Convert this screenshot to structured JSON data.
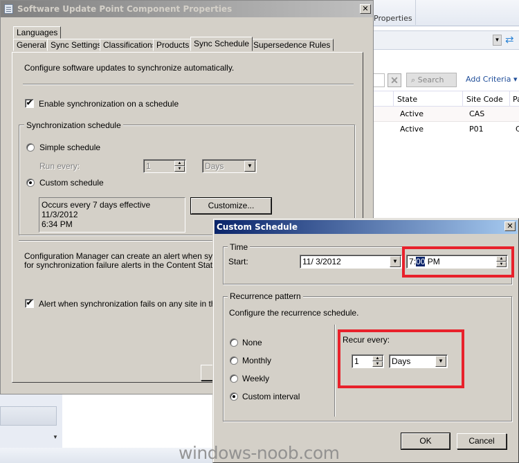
{
  "background_console": {
    "ribbon_tab": "Properties",
    "search_button": "Search",
    "add_criteria": "Add Criteria ▾",
    "columns": [
      "State",
      "Site Code",
      "Pa"
    ],
    "rows": [
      {
        "state": "Active",
        "site_code": "CAS",
        "extra": ""
      },
      {
        "state": "Active",
        "site_code": "P01",
        "extra": "C"
      }
    ]
  },
  "main_dialog": {
    "title": "Software Update Point Component Properties",
    "close_glyph": "✕",
    "tabs_row1": [
      "Languages"
    ],
    "tabs_row2": [
      "General",
      "Sync Settings",
      "Classifications",
      "Products",
      "Sync Schedule",
      "Supersedence Rules"
    ],
    "active_tab": "Sync Schedule",
    "intro": "Configure software updates to synchronize automatically.",
    "enable_sync_label": "Enable synchronization on a schedule",
    "enable_sync_checked": true,
    "schedule_group_label": "Synchronization schedule",
    "simple_schedule_label": "Simple schedule",
    "simple_schedule_selected": false,
    "run_every_label": "Run every:",
    "run_every_value": "1",
    "run_every_unit": "Days",
    "custom_schedule_label": "Custom schedule",
    "custom_schedule_selected": true,
    "schedule_summary_line1": "Occurs every 7 days effective 11/3/2012",
    "schedule_summary_line2": "6:34 PM",
    "customize_button": "Customize...",
    "alert_text_line1": "Configuration Manager can create an alert when synchror",
    "alert_text_line2": "for synchronization failure alerts in the Content Status nod",
    "alert_checkbox_label": "Alert when synchronization fails on any site in the hier",
    "alert_checked": true,
    "check_glyph": "✔"
  },
  "custom_schedule_dialog": {
    "title": "Custom Schedule",
    "close_glyph": "✕",
    "time_group_label": "Time",
    "start_label": "Start:",
    "start_date": "11/  3/2012",
    "start_time_hour": "7:",
    "start_time_minutes_selected": "00",
    "start_time_ampm": " PM",
    "recurrence_group_label": "Recurrence pattern",
    "recurrence_intro": "Configure the recurrence schedule.",
    "options": [
      {
        "label": "None",
        "selected": false
      },
      {
        "label": "Monthly",
        "selected": false
      },
      {
        "label": "Weekly",
        "selected": false
      },
      {
        "label": "Custom interval",
        "selected": true
      }
    ],
    "recur_every_label": "Recur every:",
    "recur_every_value": "1",
    "recur_every_unit": "Days",
    "ok_button": "OK",
    "cancel_button": "Cancel",
    "highlight_color": "#e8212b"
  },
  "watermark": "windows-noob.com"
}
